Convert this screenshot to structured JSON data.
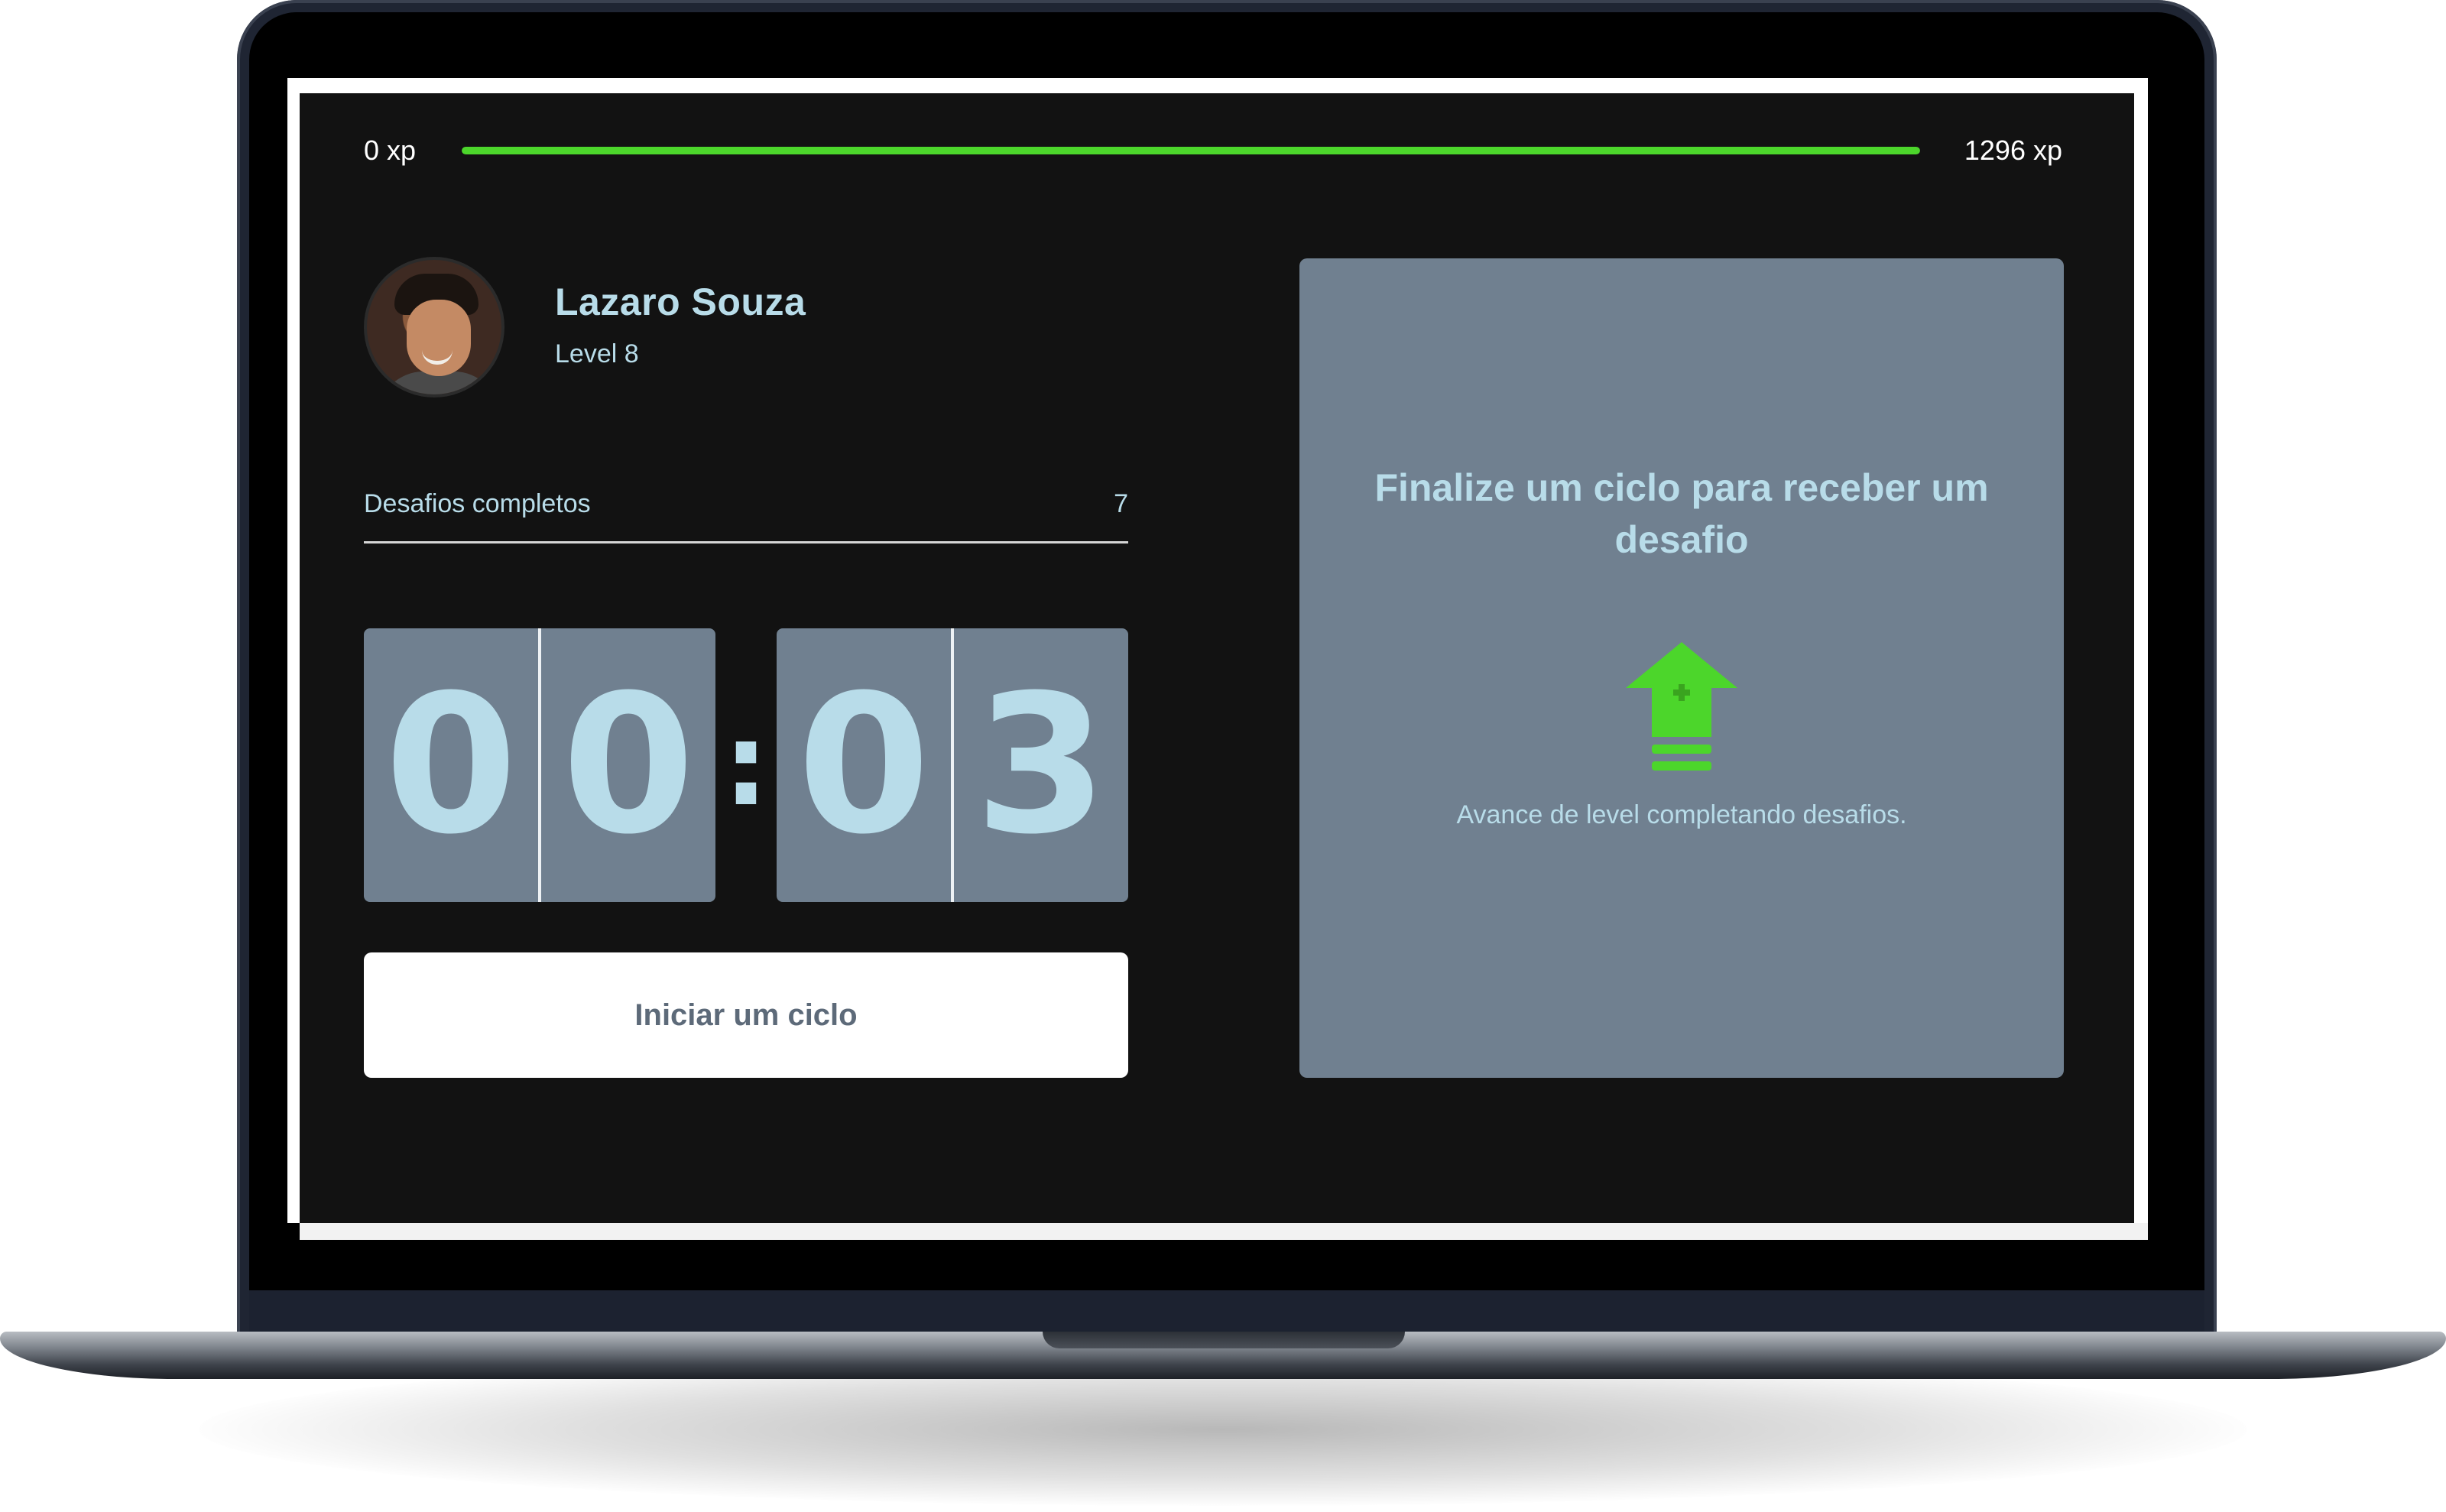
{
  "xp": {
    "min_label": "0 xp",
    "max_label": "1296 xp",
    "progress_fraction": 1.0,
    "bar_color": "#4cd62b"
  },
  "profile": {
    "name": "Lazaro Souza",
    "level": "Level 8"
  },
  "challenges": {
    "completed_label": "Desafios completos",
    "completed_value": "7"
  },
  "countdown": {
    "minute_digits": [
      "0",
      "0"
    ],
    "separator": ":",
    "second_digits": [
      "0",
      "3"
    ]
  },
  "start_button": {
    "label": "Iniciar um ciclo"
  },
  "challenge_card": {
    "title": "Finalize um ciclo para receber um desafio",
    "icon": "level-up-icon",
    "description": "Avance de level completando desafios."
  },
  "colors": {
    "screen_background": "#121212",
    "card_background": "#708090",
    "text_accent": "#b8dce9",
    "accent_green": "#4cd62b"
  }
}
